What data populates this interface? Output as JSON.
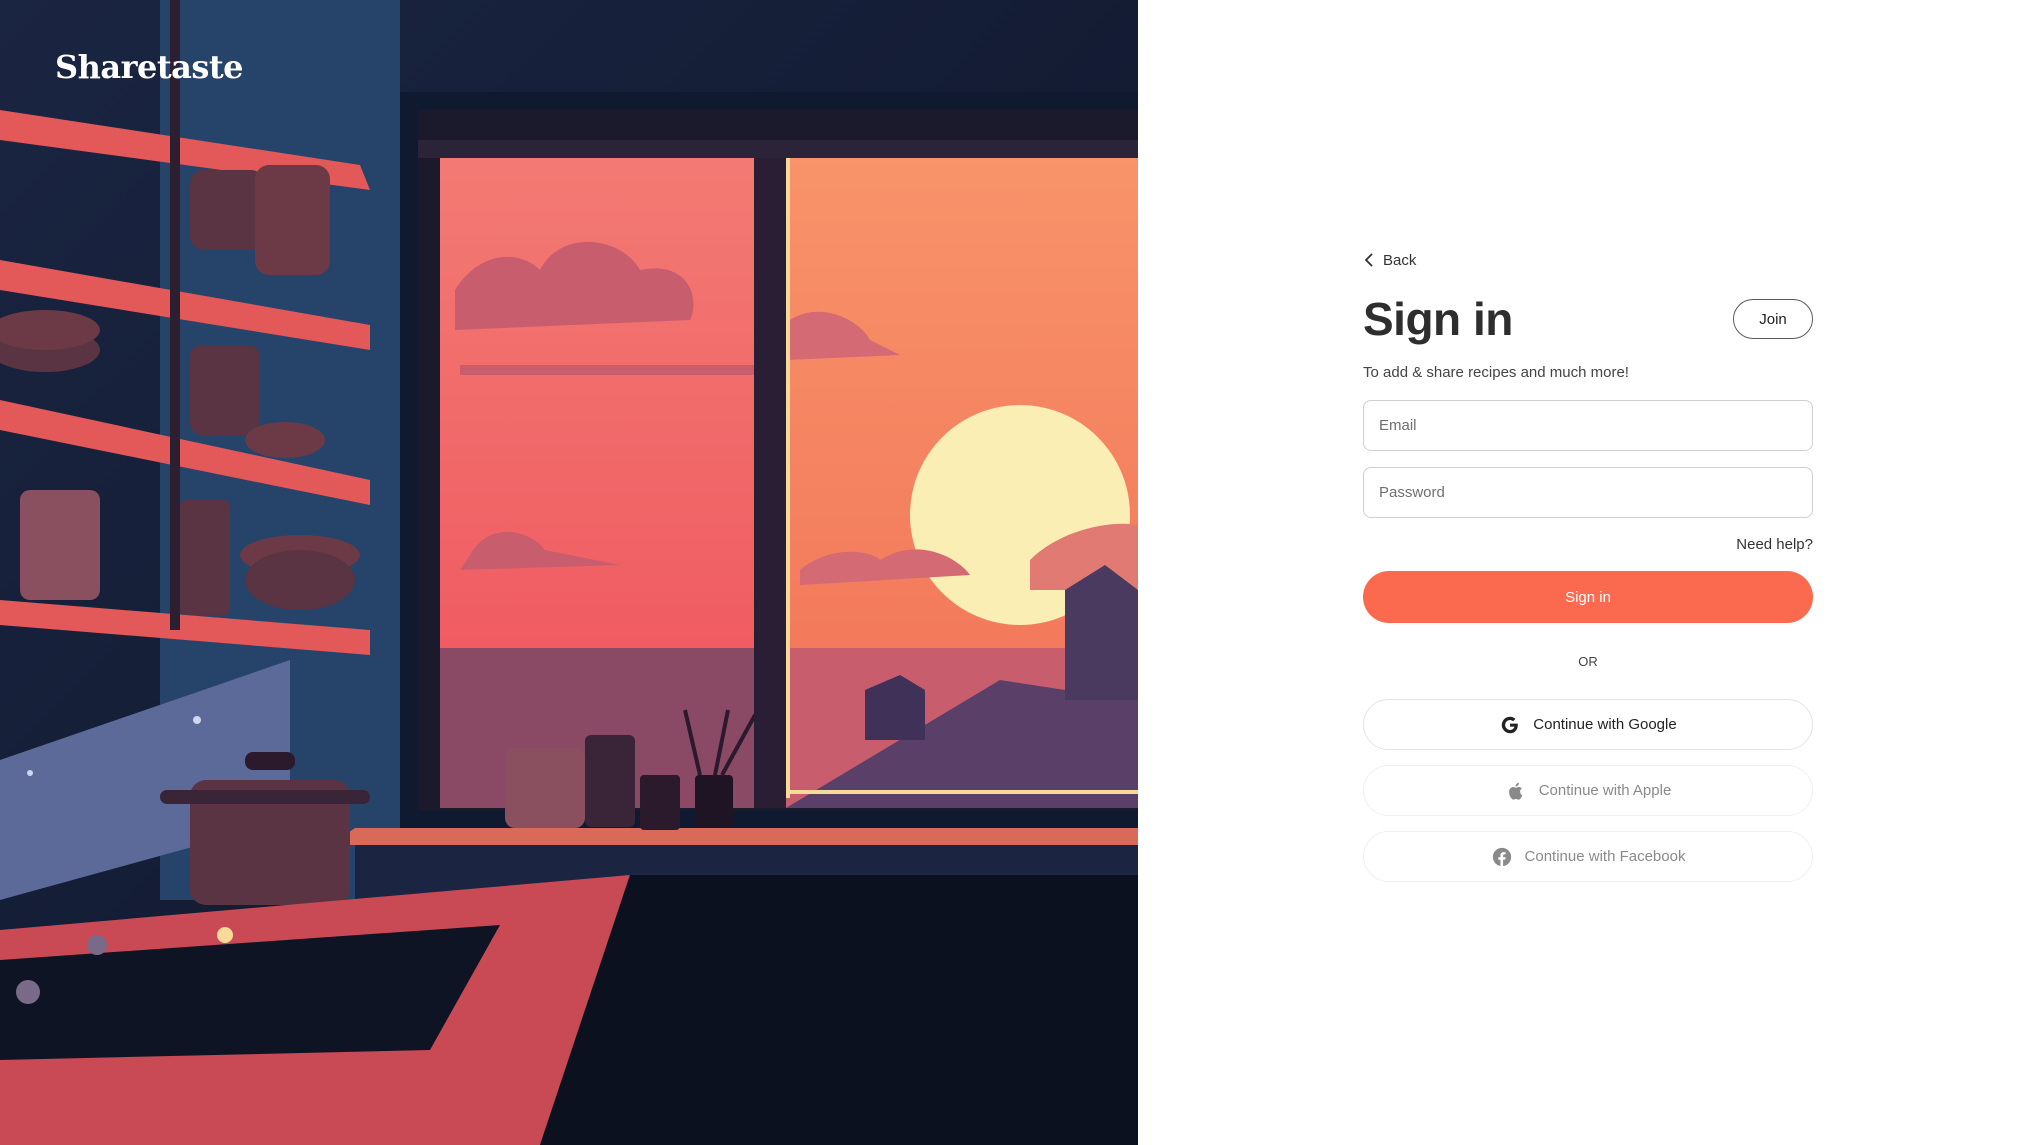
{
  "brand": {
    "name": "Sharetaste"
  },
  "signin": {
    "back_label": "Back",
    "title": "Sign in",
    "join_label": "Join",
    "subtitle": "To add & share recipes and much more!",
    "email_placeholder": "Email",
    "password_placeholder": "Password",
    "help_label": "Need help?",
    "submit_label": "Sign in",
    "divider_label": "OR",
    "social": {
      "google_label": "Continue with Google",
      "apple_label": "Continue with Apple",
      "facebook_label": "Continue with Facebook"
    }
  },
  "colors": {
    "accent": "#fb6a4f",
    "sky_pink": "#f26a6a",
    "sky_orange": "#f8925f",
    "sun": "#fbeeb4",
    "night": "#16213a"
  }
}
